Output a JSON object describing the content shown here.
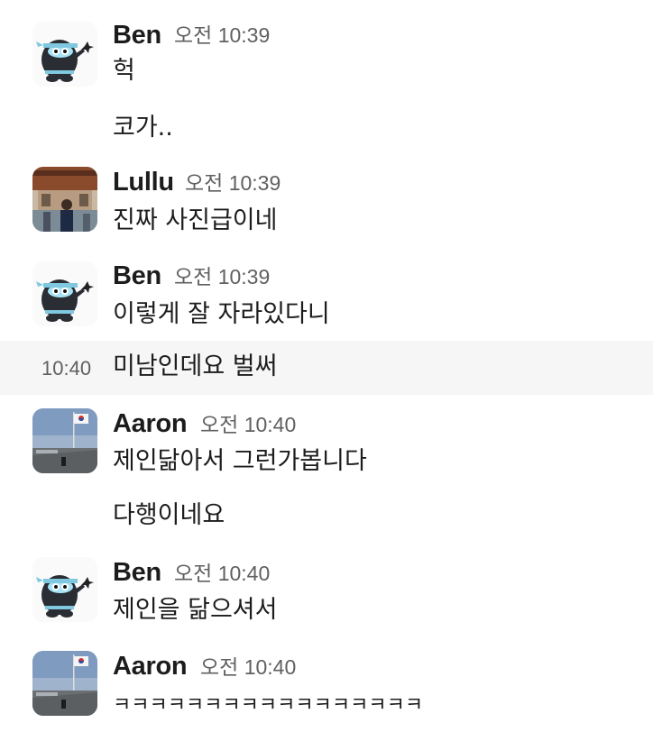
{
  "messages": [
    {
      "author": "Ben",
      "time": "오전 10:39",
      "avatar": "ben-ninja-gopher",
      "lines": [
        "헉",
        "코가.."
      ]
    },
    {
      "author": "Lullu",
      "time": "오전 10:39",
      "avatar": "lullu-photo",
      "lines": [
        "진짜 사진급이네"
      ]
    },
    {
      "author": "Ben",
      "time": "오전 10:39",
      "avatar": "ben-ninja-gopher",
      "lines": [
        "이렇게 잘 자라있다니"
      ]
    },
    {
      "hover_time": "10:40",
      "lines": [
        "미남인데요 벌써"
      ]
    },
    {
      "author": "Aaron",
      "time": "오전 10:40",
      "avatar": "aaron-photo",
      "lines": [
        "제인닮아서 그런가봅니다",
        "다행이네요"
      ]
    },
    {
      "author": "Ben",
      "time": "오전 10:40",
      "avatar": "ben-ninja-gopher",
      "lines": [
        "제인을 닮으셔서"
      ]
    },
    {
      "author": "Aaron",
      "time": "오전 10:40",
      "avatar": "aaron-photo",
      "lines": [
        "ㅋㅋㅋㅋㅋㅋㅋㅋㅋㅋㅋㅋㅋㅋㅋㅋㅋ"
      ]
    }
  ],
  "colors": {
    "text": "#1d1c1d",
    "muted": "#616061",
    "hover_bg": "#f6f6f6"
  }
}
